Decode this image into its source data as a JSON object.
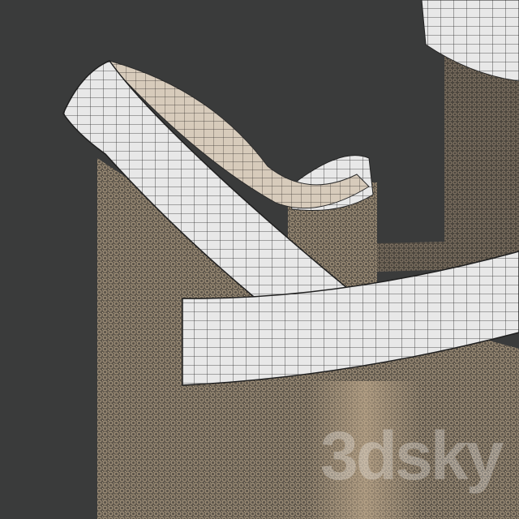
{
  "render": {
    "description_type": "3d-wireframe-render",
    "background_color": "#3a3b3b",
    "band_color": "#e8e8e8",
    "wire_color": "#2b2b2b",
    "chain_color": "#8a7c6a",
    "inner_glow_color": "#cdb595"
  },
  "watermark": {
    "text": "3dsky"
  }
}
